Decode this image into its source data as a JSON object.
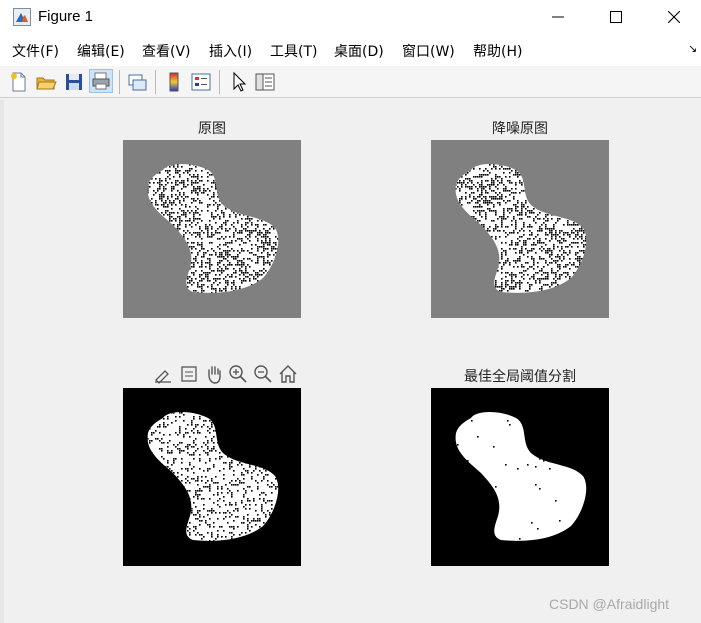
{
  "window": {
    "title": "Figure 1",
    "icon": "matlab-figure-icon"
  },
  "menu": [
    "文件(F)",
    "编辑(E)",
    "查看(V)",
    "插入(I)",
    "工具(T)",
    "桌面(D)",
    "窗口(W)",
    "帮助(H)"
  ],
  "toolbar": {
    "icons": [
      "new-figure-icon",
      "open-file-icon",
      "save-icon",
      "print-icon",
      "link-plot-icon",
      "insert-colorbar-icon",
      "insert-legend-icon",
      "edit-plot-arrow-icon",
      "property-inspector-icon"
    ]
  },
  "axes": [
    {
      "title": "原图",
      "background": "#808080",
      "shape_fill": "#ffffff",
      "noise": "heavy-black-speckle"
    },
    {
      "title": "降噪原图",
      "background": "#808080",
      "shape_fill": "#ffffff",
      "noise": "heavy-black-speckle"
    },
    {
      "title": "",
      "background": "#000000",
      "shape_fill": "#ffffff",
      "noise": "medium-black-speckle"
    },
    {
      "title": "最佳全局阈值分割",
      "background": "#000000",
      "shape_fill": "#ffffff",
      "noise": "sparse-black-dots"
    }
  ],
  "axes_toolbar": [
    "brush-icon",
    "data-tips-icon",
    "pan-hand-icon",
    "zoom-in-icon",
    "zoom-out-icon",
    "home-icon"
  ],
  "watermark": "CSDN @Afraidlight"
}
